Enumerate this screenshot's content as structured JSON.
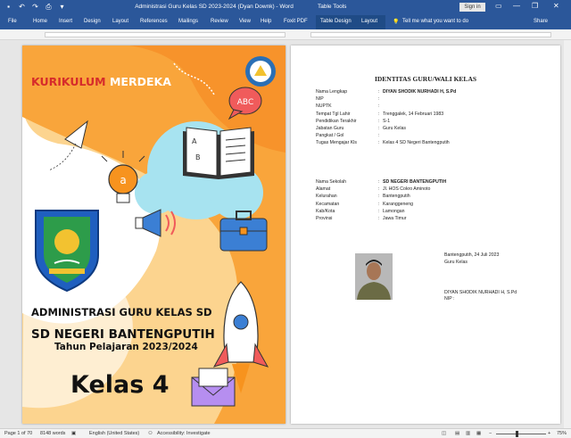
{
  "window": {
    "title": "Administrasi Guru Kelas SD 2023-2024 (Dyan Downk)  -  Word",
    "contextual_tab_group": "Table Tools",
    "sign_in": "Sign in",
    "minimize": "—",
    "restore": "❐",
    "close": "✕"
  },
  "ribbon": {
    "tabs": [
      "File",
      "Home",
      "Insert",
      "Design",
      "Layout",
      "References",
      "Mailings",
      "Review",
      "View",
      "Help",
      "Foxit PDF",
      "Table Design",
      "Layout"
    ],
    "tell_me": "Tell me what you want to do",
    "share": "Share"
  },
  "cover": {
    "kurikulum_word1": "KURIKULUM",
    "kurikulum_word2": "MERDEKA",
    "abc_bubble": "ABC",
    "heading1": "ADMINISTRASI GURU KELAS SD",
    "heading2": "SD NEGERI BANTENGPUTIH",
    "heading3": "Tahun Pelajaran 2023/2024",
    "heading4": "Kelas 4",
    "colors": {
      "orange": "#f9a53b",
      "light_orange": "#fcd48f",
      "cyan": "#a7e3f0",
      "red": "#d62b2b",
      "blue": "#3b7fd4"
    }
  },
  "identity": {
    "title": "IDENTITAS GURU/WALI KELAS",
    "rows1": [
      {
        "label": "Nama Lengkap",
        "value": "DIYAN SHODIK NURHADI H, S.Pd",
        "bold": true
      },
      {
        "label": "NIP",
        "value": ""
      },
      {
        "label": "NUPTK",
        "value": ""
      },
      {
        "label": "Tempat Tgl Lahir",
        "value": "Trenggalek, 14 Februari 1983"
      },
      {
        "label": "Pendidikan Terakhir",
        "value": "S-1"
      },
      {
        "label": "Jabatan Guru",
        "value": "Guru Kelas"
      },
      {
        "label": "Pangkat / Gol",
        "value": ""
      },
      {
        "label": "Tugas Mengajar Kls",
        "value": "Kelas 4 SD Negeri Bantengputih"
      }
    ],
    "rows2": [
      {
        "label": "Nama Sekolah",
        "value": "SD NEGERI BANTENGPUTIH",
        "bold": true
      },
      {
        "label": "Alamat",
        "value": "Jl. HOS Cokro Aminoto"
      },
      {
        "label": "Kelurahan",
        "value": "Bantengputih"
      },
      {
        "label": "Kecamatan",
        "value": "Karanggeneng"
      },
      {
        "label": "Kab/Kota",
        "value": "Lamongan"
      },
      {
        "label": "Provinsi",
        "value": "Jawa Timur"
      }
    ],
    "place_date": "Bantengputih, 24 Juli 2023",
    "role": "Guru Kelas",
    "sign_name": "DIYAN SHODIK NURHADI H, S.Pd",
    "sign_nip": "NIP :"
  },
  "status": {
    "page": "Page 1 of 70",
    "words": "8148 words",
    "language": "English (United States)",
    "accessibility": "Accessibility: Investigate",
    "zoom": "75%"
  }
}
